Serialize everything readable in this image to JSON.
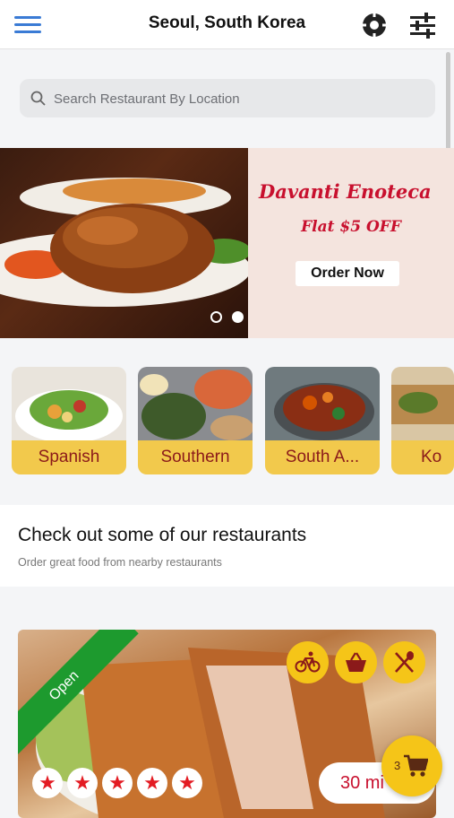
{
  "header": {
    "title": "Seoul, South Korea",
    "menu_icon": "hamburger-menu-icon",
    "location_icon": "locate-icon",
    "filter_icon": "sliders-icon"
  },
  "search": {
    "placeholder": "Search Restaurant By Location",
    "icon": "search-icon"
  },
  "banner": {
    "restaurant": "Davanti Enoteca",
    "offer": "Flat $5 OFF",
    "button": "Order Now",
    "slides": 2,
    "active_slide": 2
  },
  "categories": [
    {
      "label": "Spanish"
    },
    {
      "label": "Southern"
    },
    {
      "label": "South A..."
    },
    {
      "label": "Ko"
    }
  ],
  "section": {
    "title": "Check out some of our restaurants",
    "subtitle": "Order great food from nearby restaurants"
  },
  "restaurant_card": {
    "status": "Open",
    "actions": [
      "bicycle-icon",
      "basket-icon",
      "utensils-icon"
    ],
    "rating_stars": 5,
    "delivery_time": "30 mi"
  },
  "cart": {
    "count": "3",
    "icon": "cart-icon"
  },
  "colors": {
    "accent": "#f5c518",
    "brand_red": "#c8102e",
    "open_green": "#1d9a2e",
    "menu_blue": "#3a7bd5"
  }
}
